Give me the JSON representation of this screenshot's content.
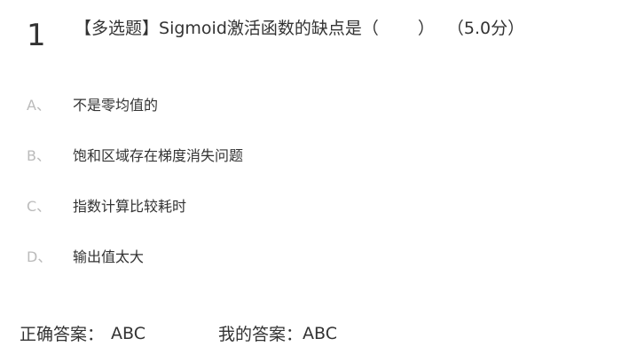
{
  "question": {
    "number": "1",
    "type_label": "【多选题】",
    "prompt": "Sigmoid激活函数的缺点是（",
    "prompt_close": "）",
    "score": "（5.0分）"
  },
  "options": [
    {
      "letter": "A、",
      "text": "不是零均值的"
    },
    {
      "letter": "B、",
      "text": "饱和区域存在梯度消失问题"
    },
    {
      "letter": "C、",
      "text": "指数计算比较耗时"
    },
    {
      "letter": "D、",
      "text": "输出值太大"
    }
  ],
  "answers": {
    "correct_label": "正确答案：",
    "correct_value": "ABC",
    "mine_label": "我的答案：",
    "mine_value": "ABC"
  }
}
